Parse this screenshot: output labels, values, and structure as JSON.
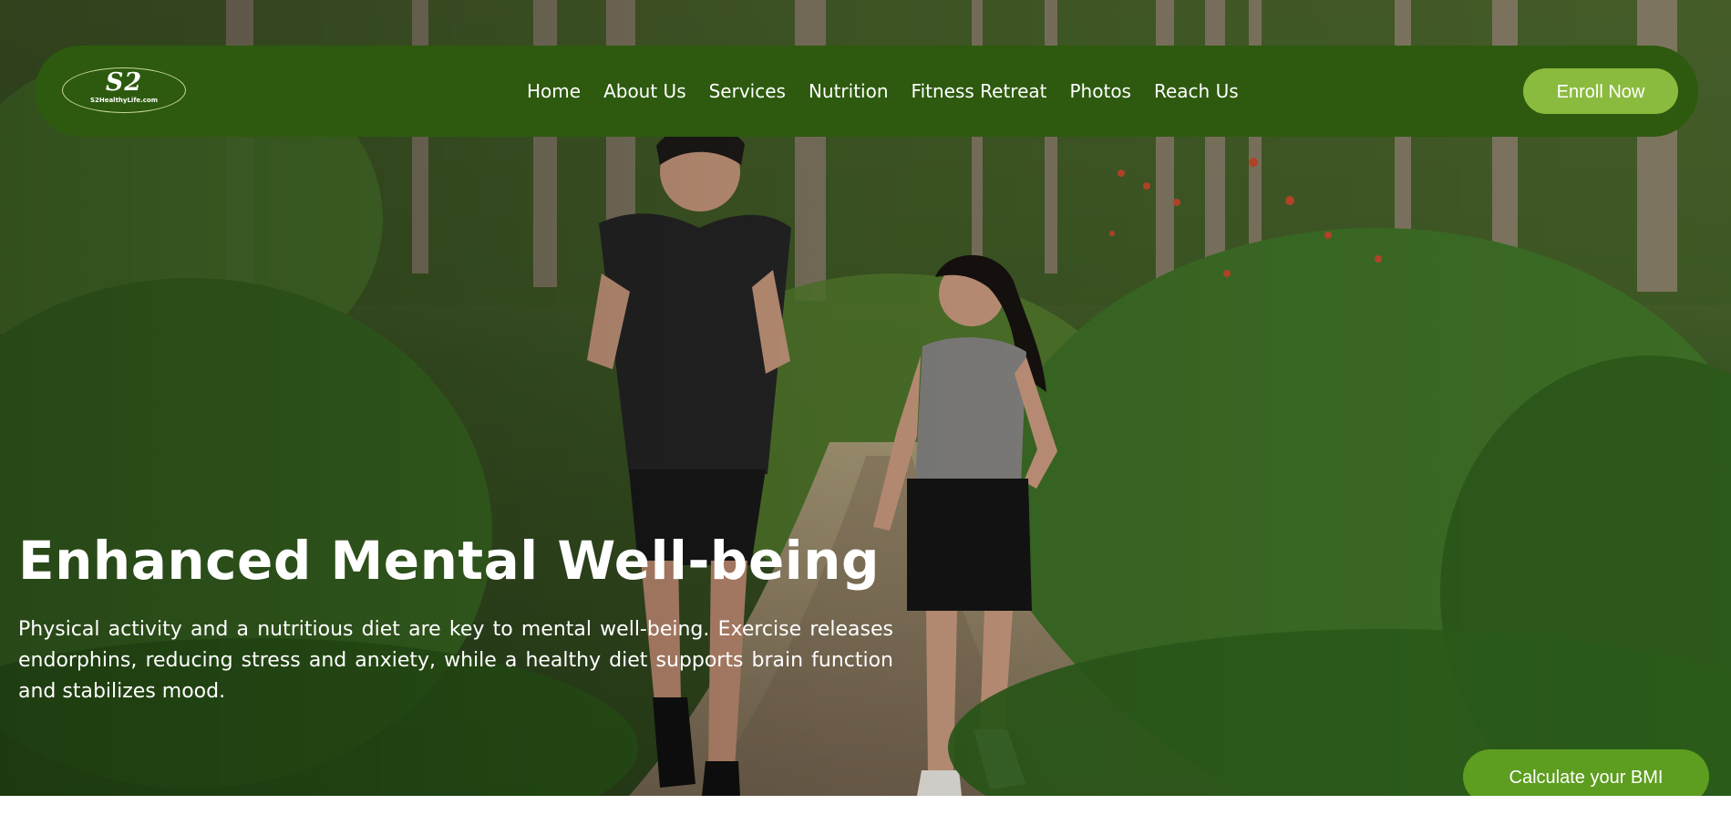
{
  "brand": {
    "logo_mark": "S2",
    "logo_domain": "S2HealthyLife.com"
  },
  "nav": {
    "items": [
      {
        "label": "Home"
      },
      {
        "label": "About Us"
      },
      {
        "label": "Services"
      },
      {
        "label": "Nutrition"
      },
      {
        "label": "Fitness Retreat"
      },
      {
        "label": "Photos"
      },
      {
        "label": "Reach Us"
      }
    ],
    "cta_label": "Enroll Now"
  },
  "hero": {
    "title": "Enhanced Mental Well-being",
    "text": "Physical activity and a nutritious diet are key to mental well-being. Exercise releases endorphins, reducing stress and anxiety, while a healthy diet supports brain function and stabilizes mood."
  },
  "floating_action": {
    "label": "Calculate your BMI"
  },
  "colors": {
    "nav_background": "#2d5a0e",
    "enroll_button": "#8bbb3e",
    "bmi_button": "#5d9d1f",
    "text": "#ffffff"
  }
}
